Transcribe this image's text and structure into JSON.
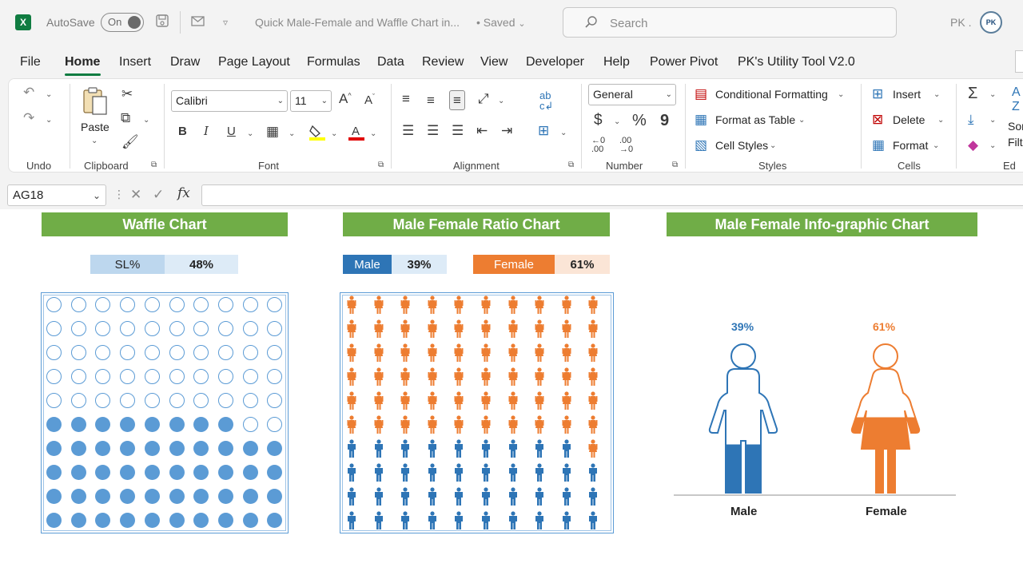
{
  "titlebar": {
    "app_letter": "X",
    "autosave_label": "AutoSave",
    "autosave_state": "On",
    "document_title": "Quick Male-Female and Waffle Chart in...",
    "save_status": "• Saved",
    "search_placeholder": "Search",
    "user_initials": "PK .",
    "avatar_text": "PK"
  },
  "menu_tabs": [
    "File",
    "Home",
    "Insert",
    "Draw",
    "Page Layout",
    "Formulas",
    "Data",
    "Review",
    "View",
    "Developer",
    "Help",
    "Power Pivot",
    "PK's Utility Tool V2.0"
  ],
  "active_tab": "Home",
  "ribbon": {
    "undo_group": "Undo",
    "clipboard": {
      "paste": "Paste",
      "group": "Clipboard"
    },
    "font": {
      "name": "Calibri",
      "size": "11",
      "group": "Font",
      "bold": "B",
      "italic": "I",
      "underline": "U"
    },
    "alignment": {
      "group": "Alignment"
    },
    "number": {
      "format": "General",
      "currency": "$",
      "percent": "%",
      "comma": "9",
      "group": "Number"
    },
    "styles": {
      "conditional": "Conditional Formatting",
      "table": "Format as Table",
      "cell_styles": "Cell Styles",
      "group": "Styles"
    },
    "cells": {
      "insert": "Insert",
      "delete": "Delete",
      "format": "Format",
      "group": "Cells"
    },
    "editing": {
      "sum": "Σ",
      "sort": "Sor",
      "filter": "Filt",
      "group": "Ed"
    }
  },
  "formula_bar": {
    "name_box": "AG18",
    "fx": "fx",
    "formula": ""
  },
  "waffle": {
    "title": "Waffle Chart",
    "kpi_label": "SL%",
    "kpi_value": "48%",
    "percent": 48
  },
  "ratio": {
    "title": "Male Female Ratio Chart",
    "male_label": "Male",
    "male_value": "39%",
    "female_label": "Female",
    "female_value": "61%",
    "male_percent": 39
  },
  "infographic": {
    "title": "Male Female Info-graphic Chart",
    "male_pct": "39%",
    "female_pct": "61%",
    "male_label": "Male",
    "female_label": "Female",
    "male_fill": 0.39,
    "female_fill": 0.61
  },
  "colors": {
    "excel_green": "#107c41",
    "header_green": "#70ad47",
    "blue": "#5b9bd5",
    "male_blue": "#2e75b6",
    "female_orange": "#ed7d31",
    "light_blue": "#bdd7ee",
    "lighter_blue": "#ddebf7",
    "light_orange": "#fbe5d6"
  }
}
